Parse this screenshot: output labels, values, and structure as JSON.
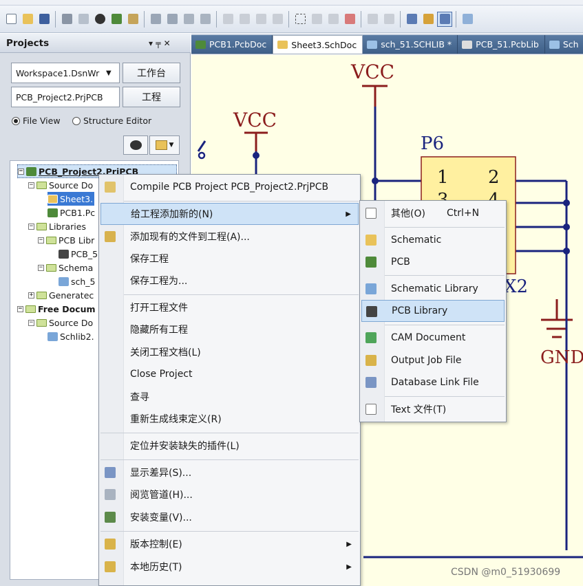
{
  "toolbar": {
    "icons": [
      "new-file-icon",
      "open-folder-icon",
      "save-icon",
      "print-icon",
      "print-preview-icon",
      "component-icon",
      "pcb-board-icon",
      "window-icon",
      "zoom-fit-icon",
      "zoom-area-icon",
      "zoom-selection-icon",
      "zoom-dropdown-icon",
      "cut-icon",
      "copy-icon",
      "paste-icon",
      "rubber-stamp-icon",
      "select-area-icon",
      "move-icon",
      "deselect-icon",
      "clear-filter-icon",
      "undo-icon",
      "redo-icon",
      "cross-probe-icon",
      "browse-icon",
      "compile-icon",
      "wire-icon"
    ]
  },
  "projects_panel": {
    "title": "Projects",
    "pin_glyph": "▾ ╤ ✕",
    "workspace_combo": "Workspace1.DsnWr",
    "workspace_button": "工作台",
    "project_combo": "PCB_Project2.PrjPCB",
    "project_button": "工程",
    "radio_file_view": "File View",
    "radio_structure_editor": "Structure Editor",
    "tree": [
      {
        "label": "PCB_Project2.PrjPCB"
      },
      {
        "label": "Source Do"
      },
      {
        "label": "Sheet3."
      },
      {
        "label": "PCB1.Pc"
      },
      {
        "label": "Libraries"
      },
      {
        "label": "PCB Libr"
      },
      {
        "label": "PCB_5"
      },
      {
        "label": "Schema"
      },
      {
        "label": "sch_5"
      },
      {
        "label": "Generatec"
      },
      {
        "label": "Free Docum"
      },
      {
        "label": "Source Do"
      },
      {
        "label": "Schlib2."
      }
    ]
  },
  "tabs": [
    {
      "label": "PCB1.PcbDoc",
      "icon": "pcb-doc-icon"
    },
    {
      "label": "Sheet3.SchDoc",
      "icon": "schematic-doc-icon"
    },
    {
      "label": "sch_51.SCHLIB *",
      "icon": "schlib-icon"
    },
    {
      "label": "PCB_51.PcbLib",
      "icon": "pcblib-icon"
    },
    {
      "label": "Sch",
      "icon": "schlib-icon"
    }
  ],
  "schematic": {
    "vcc1": "VCC",
    "vcc2": "VCC",
    "designator": "P6",
    "pin1": "1",
    "pin2": "2",
    "pin3": "3",
    "pin4": "4",
    "partial_label": "X2",
    "gnd": "GND"
  },
  "context_menu": {
    "items": [
      {
        "label": "Compile PCB Project PCB_Project2.PrjPCB",
        "icon": "compile-icon"
      },
      {
        "label": "给工程添加新的(N)",
        "icon": "",
        "submenu": true
      },
      {
        "label": "添加现有的文件到工程(A)...",
        "icon": "add-existing-icon"
      },
      {
        "label": "保存工程"
      },
      {
        "label": "保存工程为..."
      },
      {
        "label": "打开工程文件"
      },
      {
        "label": "隐藏所有工程"
      },
      {
        "label": "关闭工程文档(L)"
      },
      {
        "label": "Close Project"
      },
      {
        "label": "查寻"
      },
      {
        "label": "重新生成线束定义(R)"
      },
      {
        "label": "定位并安装缺失的插件(L)"
      },
      {
        "label": "显示差异(S)...",
        "icon": "diff-icon"
      },
      {
        "label": "阅览管道(H)...",
        "icon": "channel-icon"
      },
      {
        "label": "安装变量(V)...",
        "icon": "variant-icon"
      },
      {
        "label": "版本控制(E)",
        "icon": "lock-icon",
        "submenu": true
      },
      {
        "label": "本地历史(T)",
        "icon": "lock-icon",
        "submenu": true
      }
    ]
  },
  "submenu": {
    "items": [
      {
        "label": "其他(O)",
        "shortcut": "Ctrl+N",
        "icon": "blank-doc-icon"
      },
      {
        "label": "Schematic",
        "icon": "schematic-doc-icon"
      },
      {
        "label": "PCB",
        "icon": "pcb-doc-icon"
      },
      {
        "label": "Schematic Library",
        "icon": "schlib-icon"
      },
      {
        "label": "PCB Library",
        "icon": "pcblib-icon"
      },
      {
        "label": "CAM Document",
        "icon": "cam-icon"
      },
      {
        "label": "Output Job File",
        "icon": "output-job-icon"
      },
      {
        "label": "Database Link File",
        "icon": "database-link-icon"
      },
      {
        "label": "Text  文件(T)",
        "icon": "text-file-icon"
      }
    ]
  },
  "watermark": "CSDN @m0_51930699",
  "colors": {
    "panel_bg": "#d9dee6",
    "selection": "#cfe3f7",
    "schematic_bg": "#ffffe6",
    "wire": "#1a237e",
    "symbol": "#8b1d1d",
    "component_fill": "#fff0a0"
  }
}
